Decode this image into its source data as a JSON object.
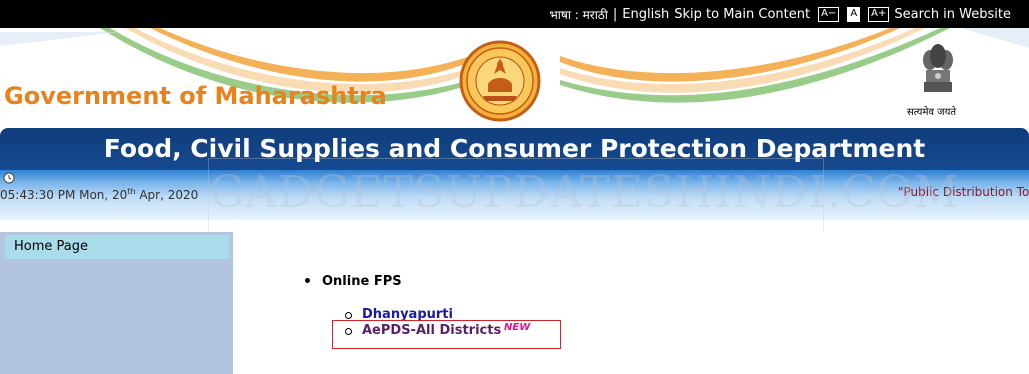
{
  "topbar": {
    "language_label": "भाषा : मराठी",
    "separator": "|",
    "english": "English",
    "skip": "Skip to Main Content",
    "font_decrease": "A−",
    "font_normal": "A",
    "font_increase": "A+",
    "search": "Search in Website"
  },
  "header": {
    "title": "Government of Maharashtra",
    "emblem_motto": "सत्यमेव जयते"
  },
  "dept_bar": {
    "title": "Food, Civil Supplies and Consumer Protection Department"
  },
  "status": {
    "time": "05:43:30 PM Mon, 20",
    "day_suffix": "th",
    "month_year": " Apr, 2020",
    "ticker": "\"Public Distribution To"
  },
  "watermark": "GADGETSUPDATESHINDI.COM",
  "sidebar": {
    "items": [
      {
        "label": "Home Page"
      }
    ]
  },
  "content": {
    "section": "Online FPS",
    "links": [
      {
        "label": "Dhanyapurti"
      },
      {
        "label": "AePDS-All Districts",
        "badge": "NEW"
      }
    ]
  },
  "colors": {
    "gov_title": "#e8821c",
    "dept_bar": "#0f3d7c",
    "sidebar": "#b2c4df",
    "sidebar_item": "#a9dcea",
    "highlight": "#d4232b"
  }
}
